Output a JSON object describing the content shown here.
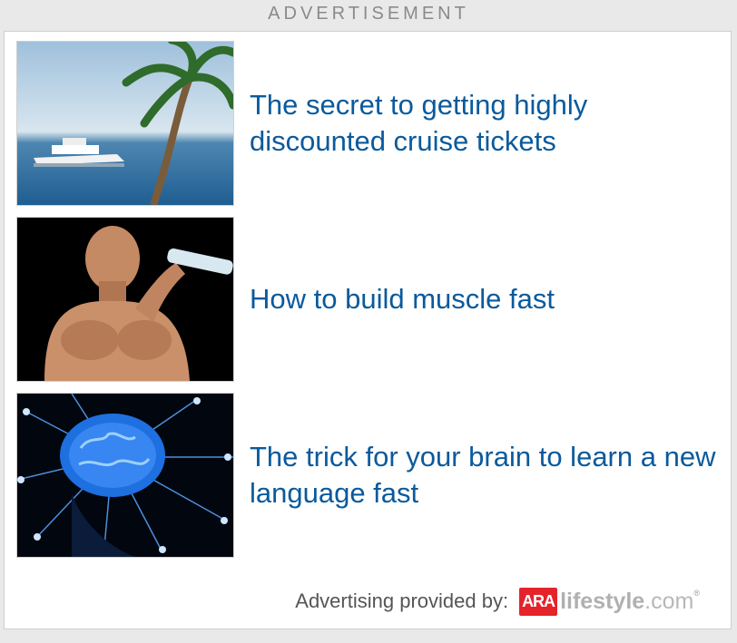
{
  "header": {
    "label": "ADVERTISEMENT"
  },
  "ads": [
    {
      "title": "The secret to getting highly discounted cruise tickets",
      "image": "cruise-ship-palm-photo"
    },
    {
      "title": "How to build muscle fast",
      "image": "muscle-man-drinking-photo"
    },
    {
      "title": "The trick for your brain to learn a new language fast",
      "image": "glowing-brain-photo"
    }
  ],
  "footer": {
    "provided_by": "Advertising provided by:",
    "logo_ara": "ARA",
    "logo_lifestyle": "lifestyle",
    "logo_com": ".com",
    "logo_tm": "®"
  },
  "colors": {
    "background": "#e9e9e9",
    "panel": "#ffffff",
    "link": "#0a5a9c",
    "brand_red": "#e4242a"
  }
}
